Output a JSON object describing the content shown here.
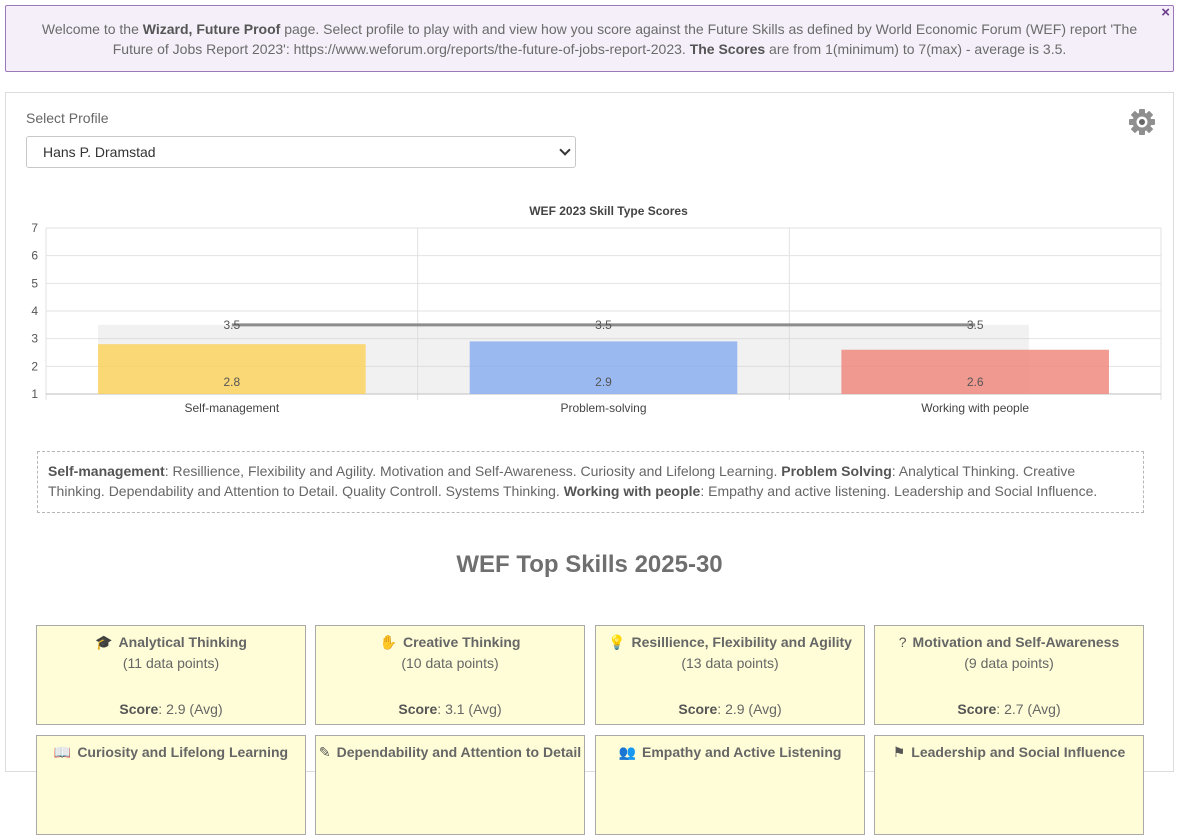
{
  "banner": {
    "t1": "Welcome to the ",
    "b1": "Wizard, Future Proof",
    "t2": " page. Select profile to play with and view how you score against the Future Skills as defined by World Economic Forum (WEF) report 'The Future of Jobs Report 2023': https://www.weforum.org/reports/the-future-of-jobs-report-2023. ",
    "b2": "The Scores",
    "t3": " are from 1(minimum) to 7(max) - average is 3.5.",
    "close": "×"
  },
  "profile": {
    "label": "Select Profile",
    "selected": "Hans P. Dramstad"
  },
  "settings_icon": "gear-icon",
  "chart_data": {
    "type": "bar",
    "title": "WEF 2023 Skill Type Scores",
    "categories": [
      "Self-management",
      "Problem-solving",
      "Working with people"
    ],
    "series": [
      {
        "values": [
          2.8,
          2.9,
          2.6
        ],
        "colors": [
          "#fad35f",
          "#8aaff0",
          "#f08a80"
        ]
      },
      {
        "type": "line",
        "values": [
          3.5,
          3.5,
          3.5
        ],
        "color": "#8c8c8c"
      }
    ],
    "data_labels": [
      "2.8",
      "2.9",
      "2.6"
    ],
    "line_labels": [
      "3.5",
      "3.5",
      "3.5"
    ],
    "yticks": [
      "1",
      "2",
      "3",
      "4",
      "5",
      "6",
      "7"
    ],
    "ylim": [
      1,
      7
    ],
    "grid": true
  },
  "description": {
    "b1": "Self-management",
    "t1": ": Resillience, Flexibility and Agility. Motivation and Self-Awareness. Curiosity and Lifelong Learning. ",
    "b2": "Problem Solving",
    "t2": ": Analytical Thinking. Creative Thinking. Dependability and Attention to Detail. Quality Controll. Systems Thinking. ",
    "b3": "Working with people",
    "t3": ": Empathy and active listening. Leadership and Social Influence."
  },
  "top_skills": {
    "heading": "WEF Top Skills 2025-30",
    "score_label": "Score",
    "cards": [
      {
        "title": "Analytical Thinking",
        "icon": "graduation-cap-icon",
        "glyph": "🎓",
        "points": "(11 data points)",
        "score": ": 2.9 (Avg)"
      },
      {
        "title": "Creative Thinking",
        "icon": "hand-icon",
        "glyph": "✋",
        "points": "(10 data points)",
        "score": ": 3.1 (Avg)"
      },
      {
        "title": "Resillience, Flexibility and Agility",
        "icon": "lightbulb-icon",
        "glyph": "💡",
        "points": "(13 data points)",
        "score": ": 2.9 (Avg)"
      },
      {
        "title": "Motivation and Self-Awareness",
        "icon": "question-icon",
        "glyph": "?",
        "points": "(9 data points)",
        "score": ": 2.7 (Avg)"
      },
      {
        "title": "Curiosity and Lifelong Learning",
        "icon": "book-icon",
        "glyph": "📖",
        "points": "",
        "score": ""
      },
      {
        "title": "Dependability and Attention to Detail",
        "icon": "pencil-icon",
        "glyph": "✎",
        "points": "",
        "score": ""
      },
      {
        "title": "Empathy and Active Listening",
        "icon": "people-icon",
        "glyph": "👥",
        "points": "",
        "score": ""
      },
      {
        "title": "Leadership and Social Influence",
        "icon": "signpost-icon",
        "glyph": "⚑",
        "points": "",
        "score": ""
      }
    ]
  }
}
